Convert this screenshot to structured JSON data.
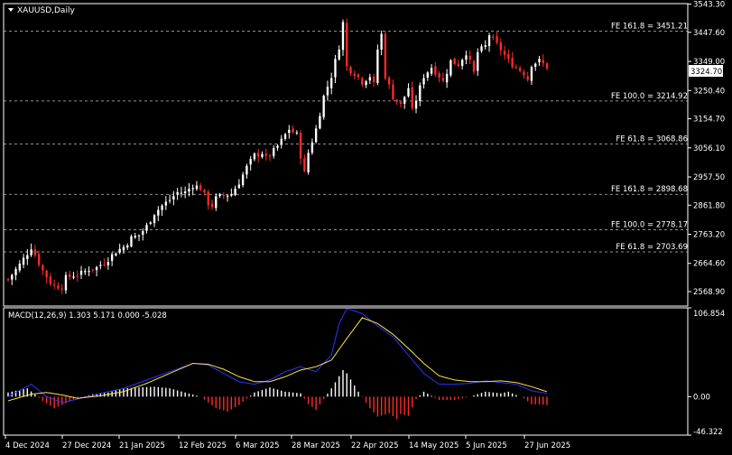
{
  "symbol_label": "XAUUSD,Daily",
  "colors": {
    "background": "#000000",
    "frame": "#ffffff",
    "bull": "#ffffff",
    "bear": "#ff2a2a",
    "fib": "#c0c0c0",
    "macd_line": "#2a35ff",
    "signal_line": "#ffe14a",
    "hist_pos": "#ffffff",
    "hist_neg": "#ff2a2a",
    "text": "#ffffff",
    "price_tag_bg": "#ffffff",
    "price_tag_text": "#000000"
  },
  "chart_data": [
    {
      "type": "candlestick",
      "ylim": [
        2520,
        3545
      ],
      "y_ticks": [
        "3543.30",
        "3447.60",
        "3349.00",
        "3250.40",
        "3154.70",
        "3056.10",
        "2957.50",
        "2861.80",
        "2763.20",
        "2664.60",
        "2568.90"
      ],
      "x_ticks": [
        "4 Dec 2024",
        "27 Dec 2024",
        "21 Jan 2025",
        "12 Feb 2025",
        "6 Mar 2025",
        "28 Mar 2025",
        "22 Apr 2025",
        "14 May 2025",
        "5 Jun 2025",
        "27 Jun 2025"
      ],
      "current_price": "3324.70",
      "fib_levels": [
        {
          "label": "FE 161.8 = 3451.21",
          "value": 3451.21
        },
        {
          "label": "FE 100.0 = 3214.92",
          "value": 3214.92
        },
        {
          "label": "FE 61.8 = 3068.86",
          "value": 3068.86
        },
        {
          "label": "FE 161.8 = 2898.68",
          "value": 2898.68
        },
        {
          "label": "FE 100.0 = 2778.17",
          "value": 2778.17
        },
        {
          "label": "FE 61.8 = 2703.69",
          "value": 2703.69
        }
      ],
      "close_path": [
        [
          0,
          2610
        ],
        [
          3,
          2660
        ],
        [
          6,
          2720
        ],
        [
          9,
          2640
        ],
        [
          11,
          2600
        ],
        [
          12,
          2590
        ],
        [
          14,
          2585
        ],
        [
          15,
          2615
        ],
        [
          17,
          2625
        ],
        [
          19,
          2630
        ],
        [
          21,
          2645
        ],
        [
          23,
          2650
        ],
        [
          25,
          2670
        ],
        [
          26,
          2680
        ],
        [
          28,
          2705
        ],
        [
          30,
          2720
        ],
        [
          32,
          2750
        ],
        [
          34,
          2760
        ],
        [
          36,
          2790
        ],
        [
          38,
          2835
        ],
        [
          40,
          2860
        ],
        [
          42,
          2880
        ],
        [
          44,
          2905
        ],
        [
          46,
          2905
        ],
        [
          48,
          2930
        ],
        [
          50,
          2920
        ],
        [
          52,
          2870
        ],
        [
          53,
          2860
        ],
        [
          54,
          2885
        ],
        [
          56,
          2895
        ],
        [
          58,
          2900
        ],
        [
          60,
          2940
        ],
        [
          62,
          2990
        ],
        [
          64,
          3030
        ],
        [
          66,
          3040
        ],
        [
          67,
          3020
        ],
        [
          69,
          3045
        ],
        [
          71,
          3080
        ],
        [
          73,
          3120
        ],
        [
          75,
          3100
        ],
        [
          76,
          3030
        ],
        [
          77,
          2970
        ],
        [
          78,
          3040
        ],
        [
          80,
          3120
        ],
        [
          82,
          3230
        ],
        [
          84,
          3300
        ],
        [
          86,
          3400
        ],
        [
          87,
          3480
        ],
        [
          88,
          3330
        ],
        [
          90,
          3310
        ],
        [
          92,
          3280
        ],
        [
          94,
          3300
        ],
        [
          95,
          3270
        ],
        [
          96,
          3390
        ],
        [
          97,
          3440
        ],
        [
          98,
          3300
        ],
        [
          100,
          3230
        ],
        [
          102,
          3200
        ],
        [
          104,
          3260
        ],
        [
          105,
          3180
        ],
        [
          106,
          3220
        ],
        [
          107,
          3260
        ],
        [
          108,
          3300
        ],
        [
          110,
          3330
        ],
        [
          112,
          3300
        ],
        [
          113,
          3280
        ],
        [
          115,
          3350
        ],
        [
          117,
          3340
        ],
        [
          119,
          3380
        ],
        [
          121,
          3310
        ],
        [
          122,
          3380
        ],
        [
          124,
          3400
        ],
        [
          125,
          3440
        ],
        [
          126,
          3420
        ],
        [
          128,
          3390
        ],
        [
          130,
          3350
        ],
        [
          132,
          3330
        ],
        [
          134,
          3310
        ],
        [
          135,
          3290
        ],
        [
          136,
          3340
        ],
        [
          138,
          3350
        ],
        [
          140,
          3330
        ]
      ]
    },
    {
      "type": "bar+line",
      "name": "MACD(12,26,9) 1.303 5.171 0.000 -5.028",
      "ylim": [
        -46.322,
        106.854
      ],
      "y_ticks": [
        "106.854",
        "0.00",
        "-46.322"
      ],
      "macd_path": [
        [
          0,
          0
        ],
        [
          6,
          15
        ],
        [
          10,
          0
        ],
        [
          14,
          -7
        ],
        [
          18,
          -3
        ],
        [
          24,
          4
        ],
        [
          30,
          10
        ],
        [
          36,
          20
        ],
        [
          42,
          30
        ],
        [
          48,
          40
        ],
        [
          52,
          38
        ],
        [
          56,
          28
        ],
        [
          60,
          18
        ],
        [
          64,
          15
        ],
        [
          68,
          20
        ],
        [
          72,
          30
        ],
        [
          76,
          36
        ],
        [
          80,
          30
        ],
        [
          84,
          50
        ],
        [
          86,
          88
        ],
        [
          88,
          106
        ],
        [
          92,
          100
        ],
        [
          96,
          85
        ],
        [
          100,
          72
        ],
        [
          104,
          50
        ],
        [
          108,
          28
        ],
        [
          112,
          15
        ],
        [
          116,
          15
        ],
        [
          120,
          16
        ],
        [
          124,
          19
        ],
        [
          128,
          17
        ],
        [
          132,
          15
        ],
        [
          136,
          7
        ],
        [
          140,
          4
        ]
      ],
      "signal_path": [
        [
          0,
          -5
        ],
        [
          6,
          3
        ],
        [
          10,
          5
        ],
        [
          14,
          2
        ],
        [
          18,
          -2
        ],
        [
          24,
          1
        ],
        [
          30,
          6
        ],
        [
          36,
          16
        ],
        [
          42,
          28
        ],
        [
          48,
          40
        ],
        [
          52,
          39
        ],
        [
          56,
          33
        ],
        [
          60,
          24
        ],
        [
          64,
          18
        ],
        [
          68,
          18
        ],
        [
          72,
          24
        ],
        [
          76,
          32
        ],
        [
          80,
          36
        ],
        [
          84,
          44
        ],
        [
          88,
          70
        ],
        [
          92,
          95
        ],
        [
          96,
          88
        ],
        [
          100,
          75
        ],
        [
          104,
          58
        ],
        [
          108,
          40
        ],
        [
          112,
          25
        ],
        [
          116,
          20
        ],
        [
          120,
          18
        ],
        [
          124,
          18
        ],
        [
          128,
          19
        ],
        [
          132,
          17
        ],
        [
          136,
          12
        ],
        [
          140,
          6
        ]
      ],
      "histogram_path": [
        [
          0,
          5
        ],
        [
          5,
          10
        ],
        [
          9,
          -5
        ],
        [
          12,
          -14
        ],
        [
          15,
          -8
        ],
        [
          18,
          -2
        ],
        [
          22,
          3
        ],
        [
          26,
          5
        ],
        [
          30,
          10
        ],
        [
          34,
          11
        ],
        [
          38,
          12
        ],
        [
          42,
          10
        ],
        [
          46,
          5
        ],
        [
          50,
          0
        ],
        [
          54,
          -14
        ],
        [
          57,
          -18
        ],
        [
          60,
          -10
        ],
        [
          64,
          5
        ],
        [
          68,
          11
        ],
        [
          72,
          6
        ],
        [
          76,
          4
        ],
        [
          78,
          -9
        ],
        [
          80,
          -16
        ],
        [
          84,
          10
        ],
        [
          87,
          32
        ],
        [
          88,
          28
        ],
        [
          91,
          6
        ],
        [
          94,
          -14
        ],
        [
          96,
          -24
        ],
        [
          99,
          -20
        ],
        [
          101,
          -27
        ],
        [
          102,
          -21
        ],
        [
          104,
          -23
        ],
        [
          106,
          -3
        ],
        [
          108,
          6
        ],
        [
          112,
          -4
        ],
        [
          116,
          -4
        ],
        [
          120,
          0
        ],
        [
          124,
          6
        ],
        [
          128,
          4
        ],
        [
          130,
          6
        ],
        [
          134,
          -2
        ],
        [
          136,
          -9
        ],
        [
          140,
          -10
        ]
      ]
    }
  ]
}
